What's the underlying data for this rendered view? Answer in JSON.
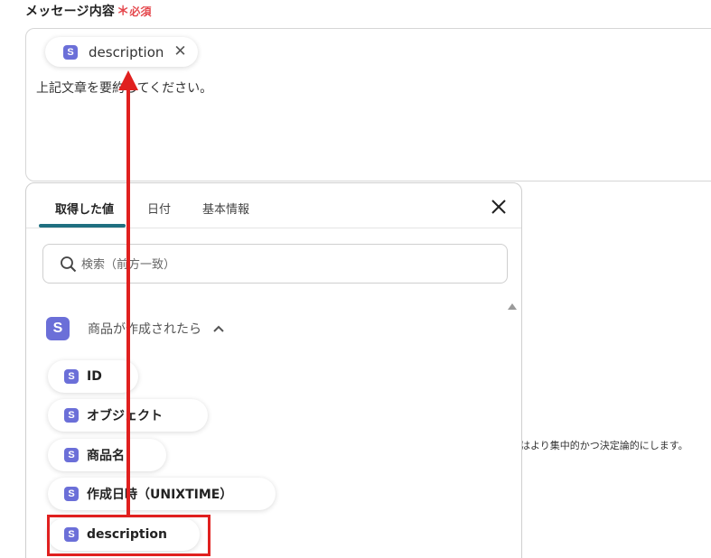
{
  "field": {
    "label": "メッセージ内容",
    "required_mark": "＊",
    "required_text": "必須"
  },
  "message": {
    "chip_badge": "S",
    "chip_label": "description",
    "chip_close": "✕",
    "text": "上記文章を要約してください。"
  },
  "side_note": "はより集中的かつ決定論的にします。",
  "panel": {
    "tabs": [
      {
        "label": "取得した値",
        "active": true
      },
      {
        "label": "日付",
        "active": false
      },
      {
        "label": "基本情報",
        "active": false
      }
    ],
    "search": {
      "placeholder": "検索（前方一致）"
    },
    "group": {
      "badge": "S",
      "title": "商品が作成されたら"
    },
    "items": [
      {
        "badge": "S",
        "label": "ID"
      },
      {
        "badge": "S",
        "label": "オブジェクト"
      },
      {
        "badge": "S",
        "label": "商品名"
      },
      {
        "badge": "S",
        "label": "作成日時（UNIXTIME）"
      },
      {
        "badge": "S",
        "label": "description"
      }
    ]
  },
  "colors": {
    "badge": "#6b6fd8",
    "required": "#e5484d",
    "tab_underline": "#1f6f80",
    "annotation": "#e0201f"
  },
  "icons": [
    "close-icon",
    "search-icon",
    "chevron-up-icon",
    "scroll-up-arrow-icon"
  ]
}
